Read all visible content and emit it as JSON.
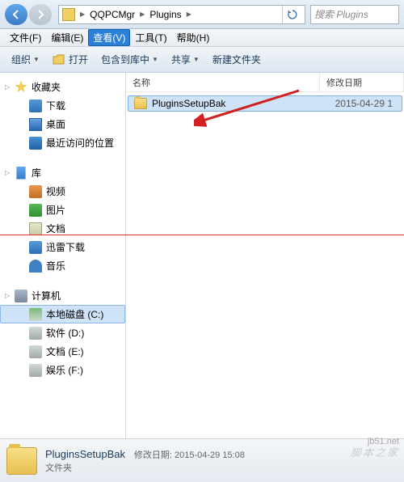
{
  "address": {
    "seg1": "QQPCMgr",
    "seg2": "Plugins"
  },
  "search": {
    "placeholder": "搜索 Plugins"
  },
  "menu": {
    "file": "文件(F)",
    "edit": "编辑(E)",
    "view": "查看(V)",
    "tools": "工具(T)",
    "help": "帮助(H)"
  },
  "toolbar": {
    "organize": "组织",
    "open": "打开",
    "include": "包含到库中",
    "share": "共享",
    "newfolder": "新建文件夹"
  },
  "nav": {
    "favorites": "收藏夹",
    "downloads": "下载",
    "desktop": "桌面",
    "recent": "最近访问的位置",
    "libraries": "库",
    "videos": "视频",
    "pictures": "图片",
    "documents": "文档",
    "xunlei": "迅雷下载",
    "music": "音乐",
    "computer": "计算机",
    "localC": "本地磁盘 (C:)",
    "diskD": "软件 (D:)",
    "diskE": "文档 (E:)",
    "diskF": "娱乐 (F:)"
  },
  "columns": {
    "name": "名称",
    "date": "修改日期"
  },
  "files": [
    {
      "name": "PluginsSetupBak",
      "date": "2015-04-29 1"
    }
  ],
  "details": {
    "name": "PluginsSetupBak",
    "modlabel": "修改日期:",
    "modvalue": "2015-04-29 15:08",
    "type": "文件夹"
  },
  "watermark1": "jb51.net",
  "watermark2": "脚本之家"
}
